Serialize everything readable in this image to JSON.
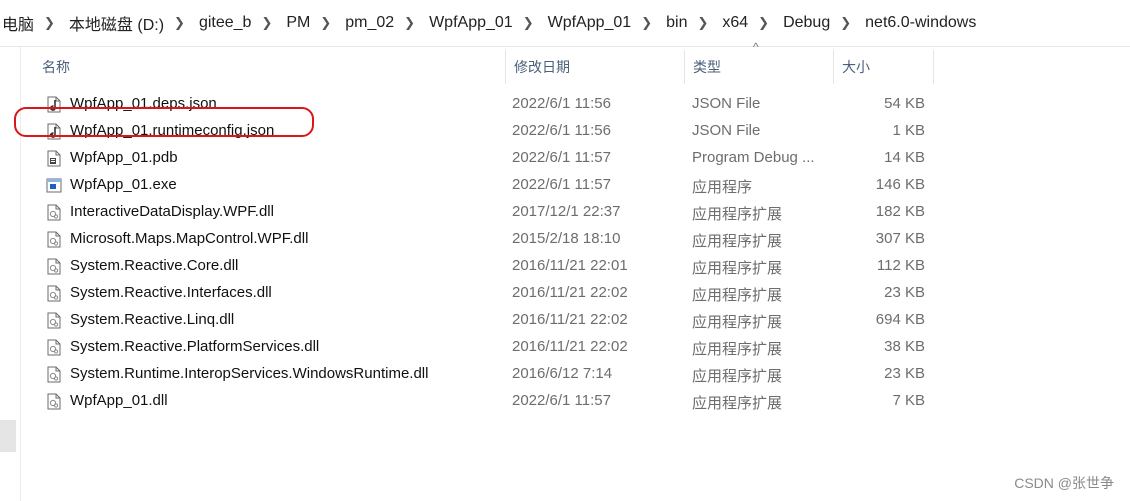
{
  "breadcrumb": [
    "电脑",
    "本地磁盘 (D:)",
    "gitee_b",
    "PM",
    "pm_02",
    "WpfApp_01",
    "WpfApp_01",
    "bin",
    "x64",
    "Debug",
    "net6.0-windows"
  ],
  "columns": {
    "name": "名称",
    "date": "修改日期",
    "type": "类型",
    "size": "大小"
  },
  "sort_indicator": "^",
  "files": [
    {
      "name": "WpfApp_01.deps.json",
      "date": "2022/6/1 11:56",
      "type": "JSON File",
      "size": "54 KB",
      "icon": "json-file-icon"
    },
    {
      "name": "WpfApp_01.runtimeconfig.json",
      "date": "2022/6/1 11:56",
      "type": "JSON File",
      "size": "1 KB",
      "icon": "json-file-icon"
    },
    {
      "name": "WpfApp_01.pdb",
      "date": "2022/6/1 11:57",
      "type": "Program Debug ...",
      "size": "14 KB",
      "icon": "pdb-file-icon"
    },
    {
      "name": "WpfApp_01.exe",
      "date": "2022/6/1 11:57",
      "type": "应用程序",
      "size": "146 KB",
      "icon": "exe-file-icon"
    },
    {
      "name": "InteractiveDataDisplay.WPF.dll",
      "date": "2017/12/1 22:37",
      "type": "应用程序扩展",
      "size": "182 KB",
      "icon": "dll-file-icon"
    },
    {
      "name": "Microsoft.Maps.MapControl.WPF.dll",
      "date": "2015/2/18 18:10",
      "type": "应用程序扩展",
      "size": "307 KB",
      "icon": "dll-file-icon"
    },
    {
      "name": "System.Reactive.Core.dll",
      "date": "2016/11/21 22:01",
      "type": "应用程序扩展",
      "size": "112 KB",
      "icon": "dll-file-icon"
    },
    {
      "name": "System.Reactive.Interfaces.dll",
      "date": "2016/11/21 22:02",
      "type": "应用程序扩展",
      "size": "23 KB",
      "icon": "dll-file-icon"
    },
    {
      "name": "System.Reactive.Linq.dll",
      "date": "2016/11/21 22:02",
      "type": "应用程序扩展",
      "size": "694 KB",
      "icon": "dll-file-icon"
    },
    {
      "name": "System.Reactive.PlatformServices.dll",
      "date": "2016/11/21 22:02",
      "type": "应用程序扩展",
      "size": "38 KB",
      "icon": "dll-file-icon"
    },
    {
      "name": "System.Runtime.InteropServices.WindowsRuntime.dll",
      "date": "2016/6/12 7:14",
      "type": "应用程序扩展",
      "size": "23 KB",
      "icon": "dll-file-icon"
    },
    {
      "name": "WpfApp_01.dll",
      "date": "2022/6/1 11:57",
      "type": "应用程序扩展",
      "size": "7 KB",
      "icon": "dll-file-icon"
    }
  ],
  "highlighted_file": "InteractiveDataDisplay.WPF.dll",
  "colors": {
    "highlight": "#d9161b",
    "header_text": "#4c607a",
    "exe_icon": "#1f5fbf"
  },
  "watermark": "CSDN @张世争"
}
